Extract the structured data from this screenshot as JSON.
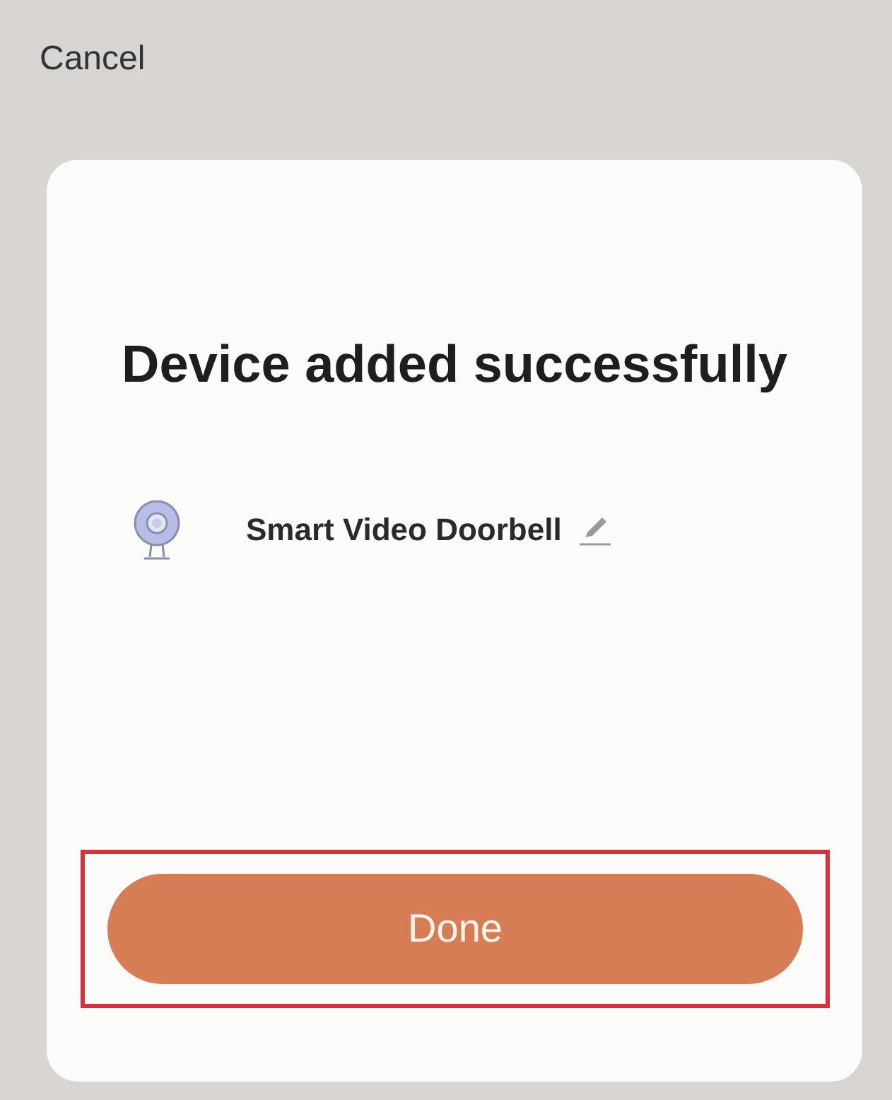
{
  "header": {
    "cancel_label": "Cancel"
  },
  "card": {
    "title": "Device added successfully",
    "device": {
      "name": "Smart Video Doorbell",
      "editable": true
    },
    "done_button": {
      "label": "Done",
      "highlighted": true
    }
  }
}
